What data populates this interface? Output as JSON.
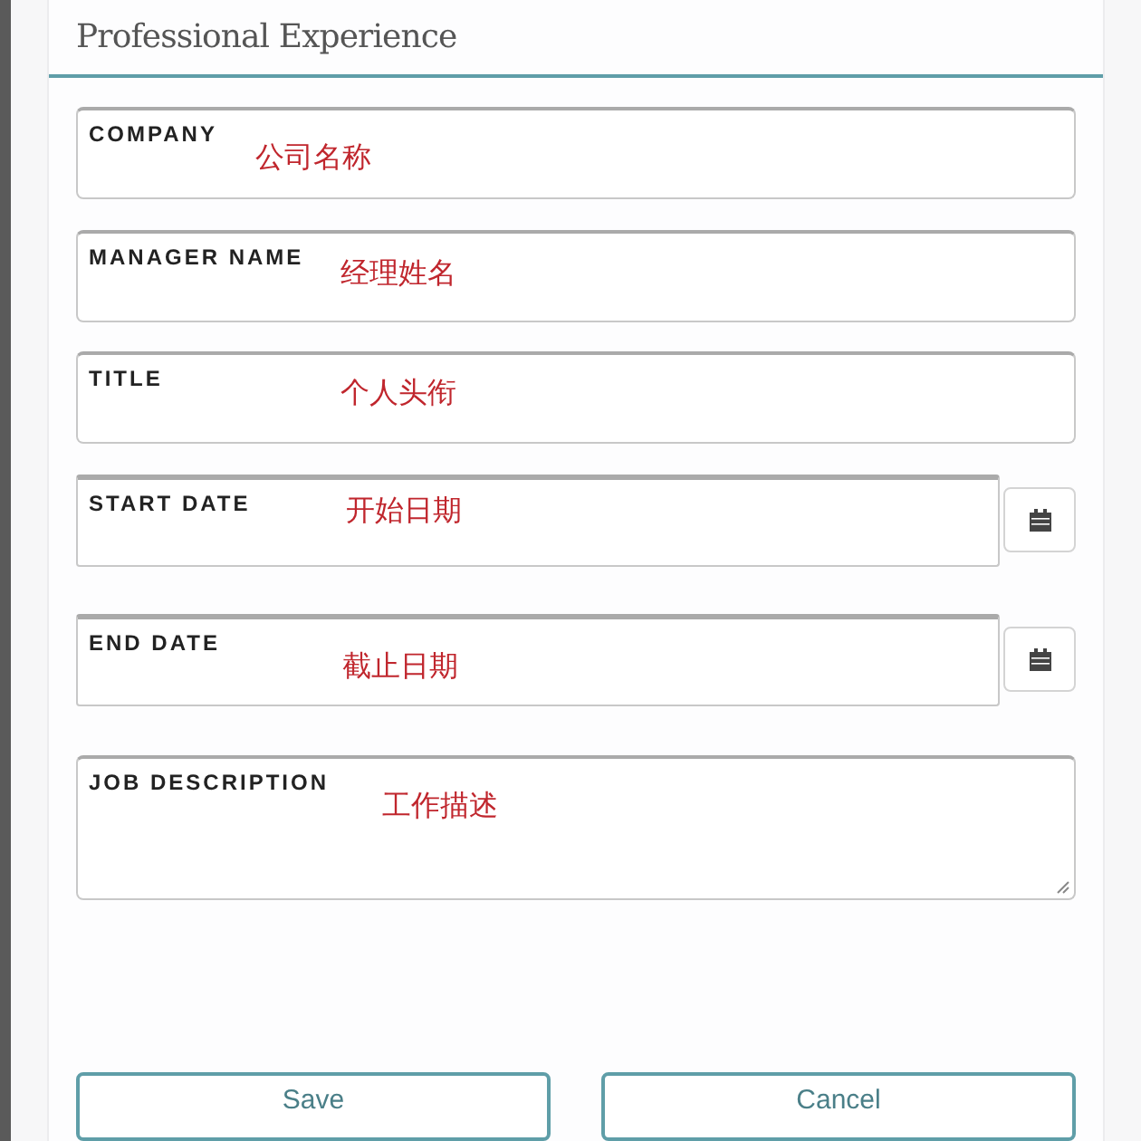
{
  "section": {
    "title": "Professional Experience"
  },
  "fields": [
    {
      "kind": "text",
      "label": "COMPANY",
      "annotation": "公司名称"
    },
    {
      "kind": "text",
      "label": "MANAGER NAME",
      "annotation": "经理姓名"
    },
    {
      "kind": "text",
      "label": "TITLE",
      "annotation": "个人头衔"
    },
    {
      "kind": "date",
      "label": "START DATE",
      "annotation": "开始日期"
    },
    {
      "kind": "date",
      "label": "END DATE",
      "annotation": "截止日期"
    },
    {
      "kind": "textarea",
      "label": "JOB DESCRIPTION",
      "annotation": "工作描述"
    }
  ],
  "buttons": [
    "Save",
    "Cancel"
  ]
}
